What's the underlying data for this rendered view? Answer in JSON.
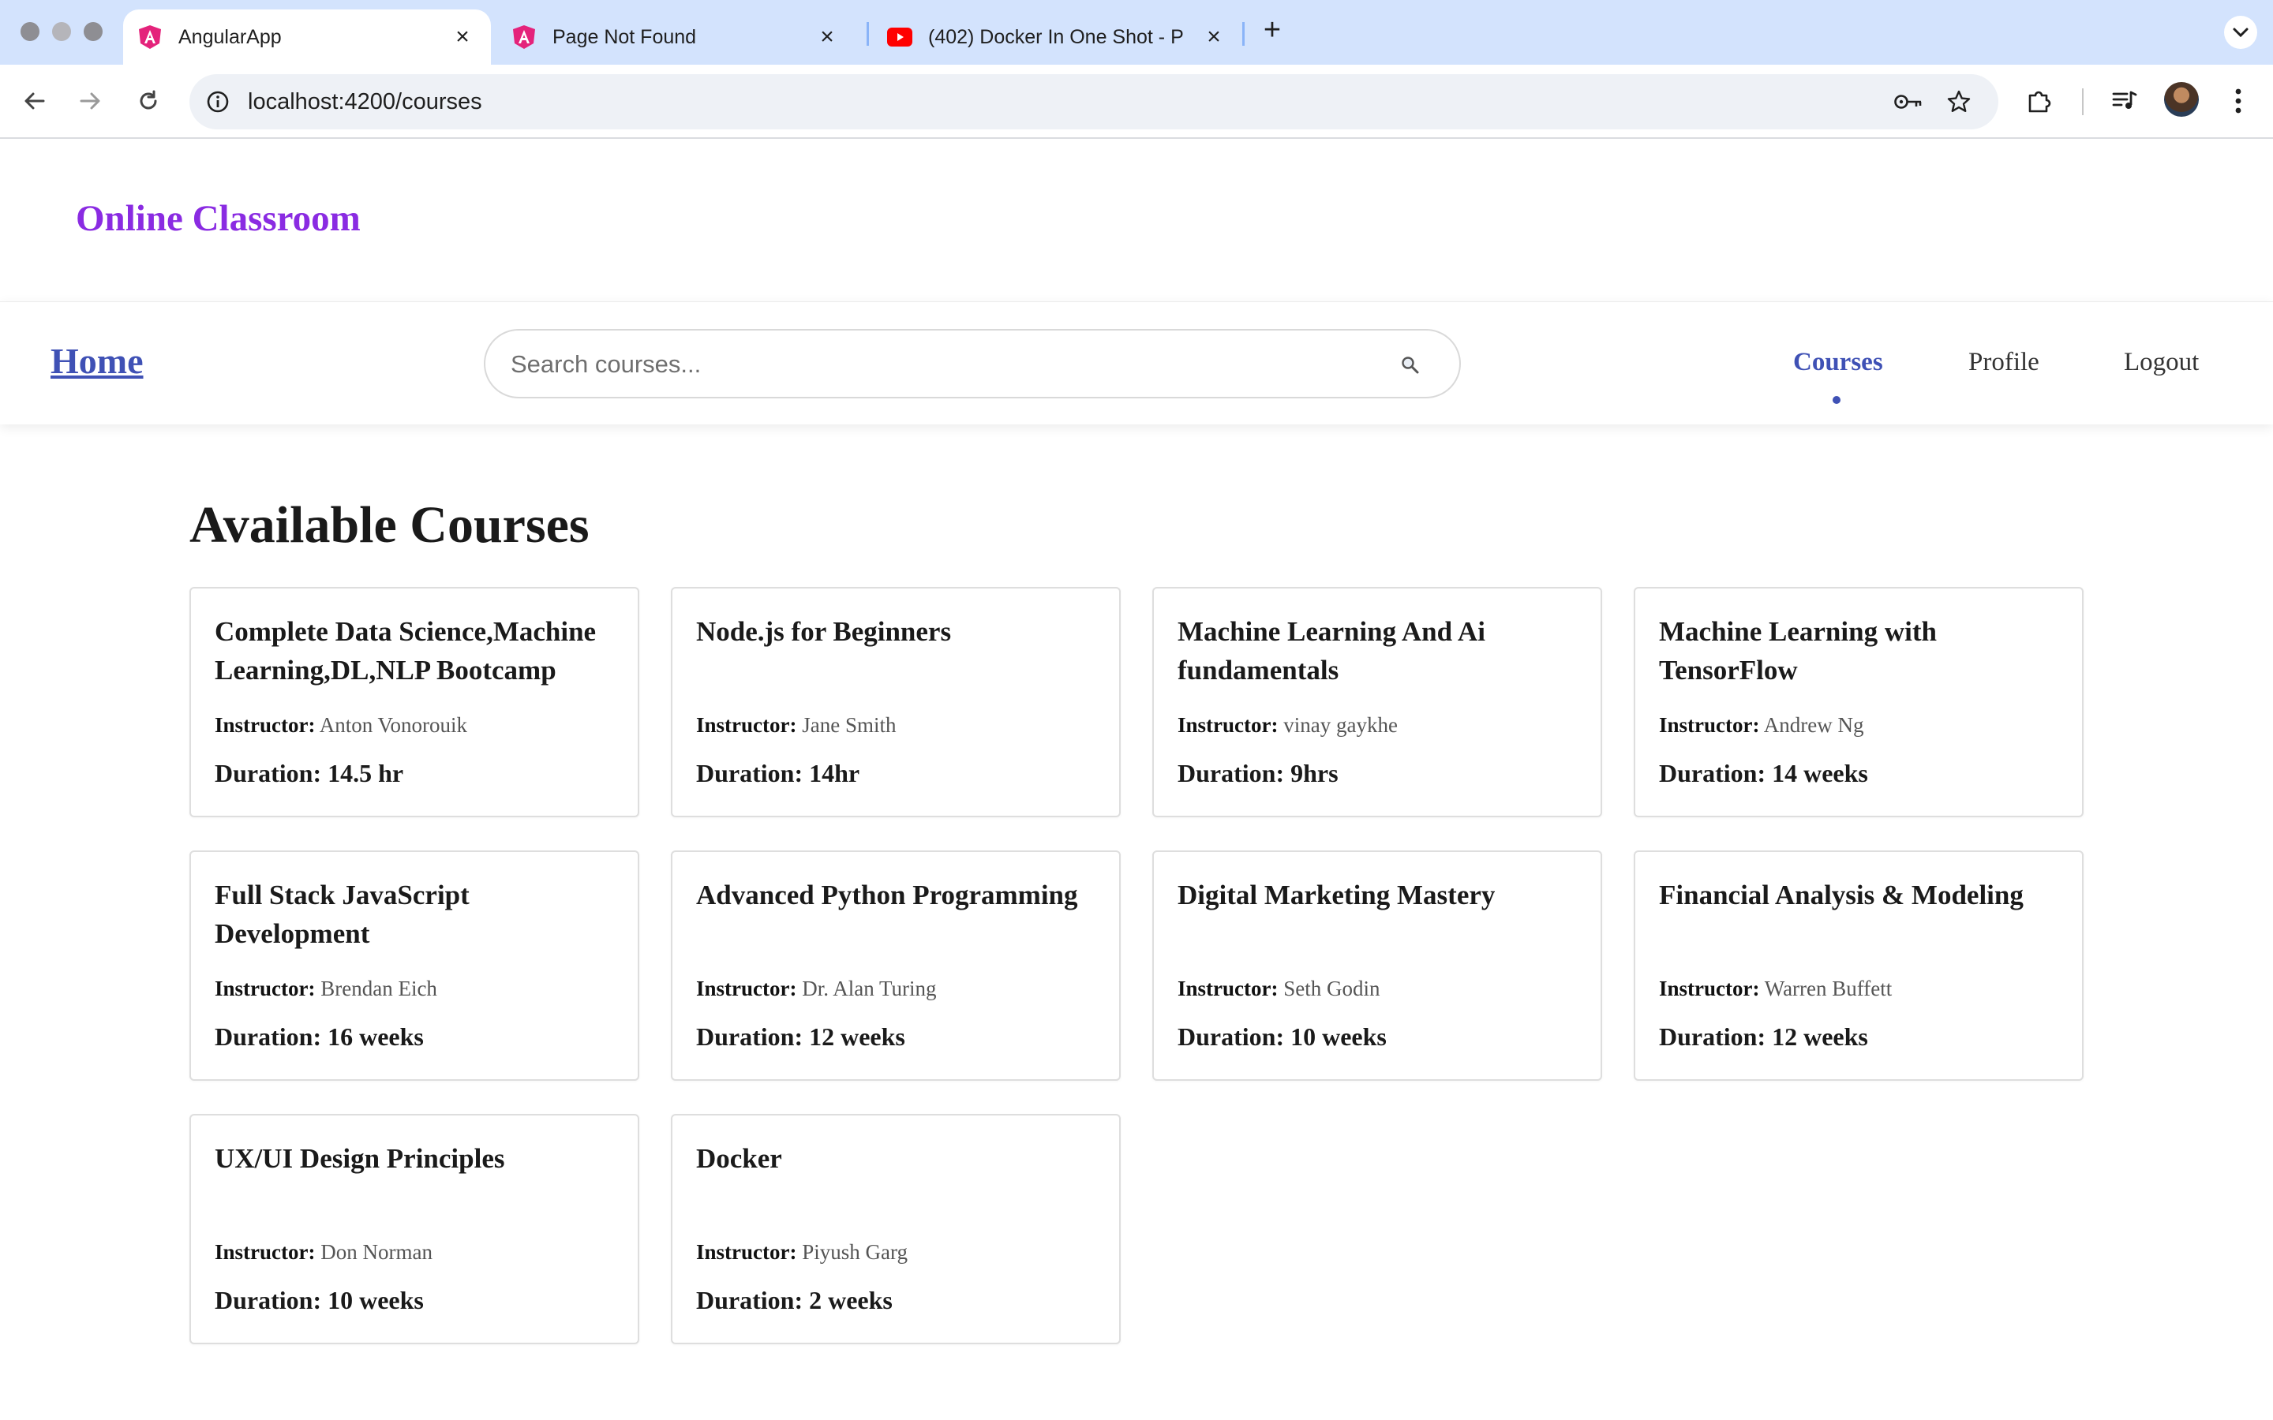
{
  "browser": {
    "tabs": [
      {
        "title": "AngularApp",
        "favicon": "angular-icon",
        "active": true
      },
      {
        "title": "Page Not Found",
        "favicon": "angular-icon",
        "active": false
      },
      {
        "title": "(402) Docker In One Shot - P",
        "favicon": "youtube-icon",
        "active": false
      }
    ],
    "url": "localhost:4200/courses",
    "colors": {
      "tabstrip": "#d3e3fd",
      "omnibox": "#eef1f6"
    }
  },
  "app": {
    "brand": "Online Classroom",
    "nav": {
      "home": "Home",
      "search_placeholder": "Search courses...",
      "links": [
        "Courses",
        "Profile",
        "Logout"
      ],
      "active": "Courses"
    },
    "colors": {
      "brand": "#8a2be2",
      "accent": "#3f51b5"
    }
  },
  "main": {
    "title": "Available Courses",
    "instructor_label": "Instructor:",
    "courses": [
      {
        "title": "Complete Data Science,Machine Learning,DL,NLP Bootcamp",
        "instructor": "Anton Vonorouik",
        "duration": "Duration: 14.5 hr"
      },
      {
        "title": "Node.js for Beginners",
        "instructor": "Jane Smith",
        "duration": "Duration: 14hr"
      },
      {
        "title": "Machine Learning And Ai fundamentals",
        "instructor": "vinay gaykhe",
        "duration": "Duration: 9hrs"
      },
      {
        "title": "Machine Learning with TensorFlow",
        "instructor": "Andrew Ng",
        "duration": "Duration: 14 weeks"
      },
      {
        "title": "Full Stack JavaScript Development",
        "instructor": "Brendan Eich",
        "duration": "Duration: 16 weeks"
      },
      {
        "title": "Advanced Python Programming",
        "instructor": "Dr. Alan Turing",
        "duration": "Duration: 12 weeks"
      },
      {
        "title": "Digital Marketing Mastery",
        "instructor": "Seth Godin",
        "duration": "Duration: 10 weeks"
      },
      {
        "title": "Financial Analysis & Modeling",
        "instructor": "Warren Buffett",
        "duration": "Duration: 12 weeks"
      },
      {
        "title": "UX/UI Design Principles",
        "instructor": "Don Norman",
        "duration": "Duration: 10 weeks"
      },
      {
        "title": "Docker",
        "instructor": "Piyush Garg",
        "duration": "Duration: 2 weeks"
      }
    ]
  }
}
